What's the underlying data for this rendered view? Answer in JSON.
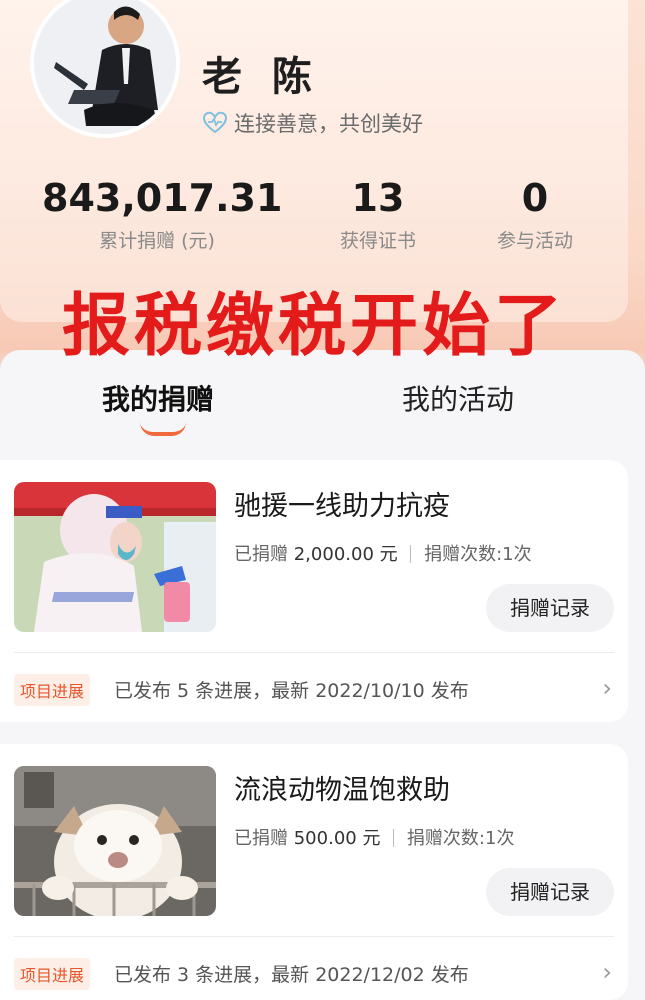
{
  "profile": {
    "name": "老 陈",
    "slogan": "连接善意，共创美好",
    "stats": [
      {
        "value": "843,017.31",
        "label": "累计捐赠 (元)"
      },
      {
        "value": "13",
        "label": "获得证书"
      },
      {
        "value": "0",
        "label": "参与活动"
      }
    ]
  },
  "overlay_text": "报税缴税开始了",
  "tabs": {
    "active": "我的捐赠",
    "inactive": "我的活动"
  },
  "donations": [
    {
      "title": "驰援一线助力抗疫",
      "amount_label": "已捐赠",
      "amount": "2,000.00 元",
      "count_label": "捐赠次数:1次",
      "record_button": "捐赠记录",
      "badge": "项目进展",
      "progress": "已发布 5 条进展，最新 2022/10/10 发布",
      "chevron": "›"
    },
    {
      "title": "流浪动物温饱救助",
      "amount_label": "已捐赠",
      "amount": "500.00 元",
      "count_label": "捐赠次数:1次",
      "record_button": "捐赠记录",
      "badge": "项目进展",
      "progress": "已发布 3 条进展，最新 2022/12/02 发布",
      "chevron": "›"
    }
  ],
  "colors": {
    "accent": "#f06a3c",
    "overlay": "#e31b1b",
    "badge_bg": "#fdeee7"
  }
}
